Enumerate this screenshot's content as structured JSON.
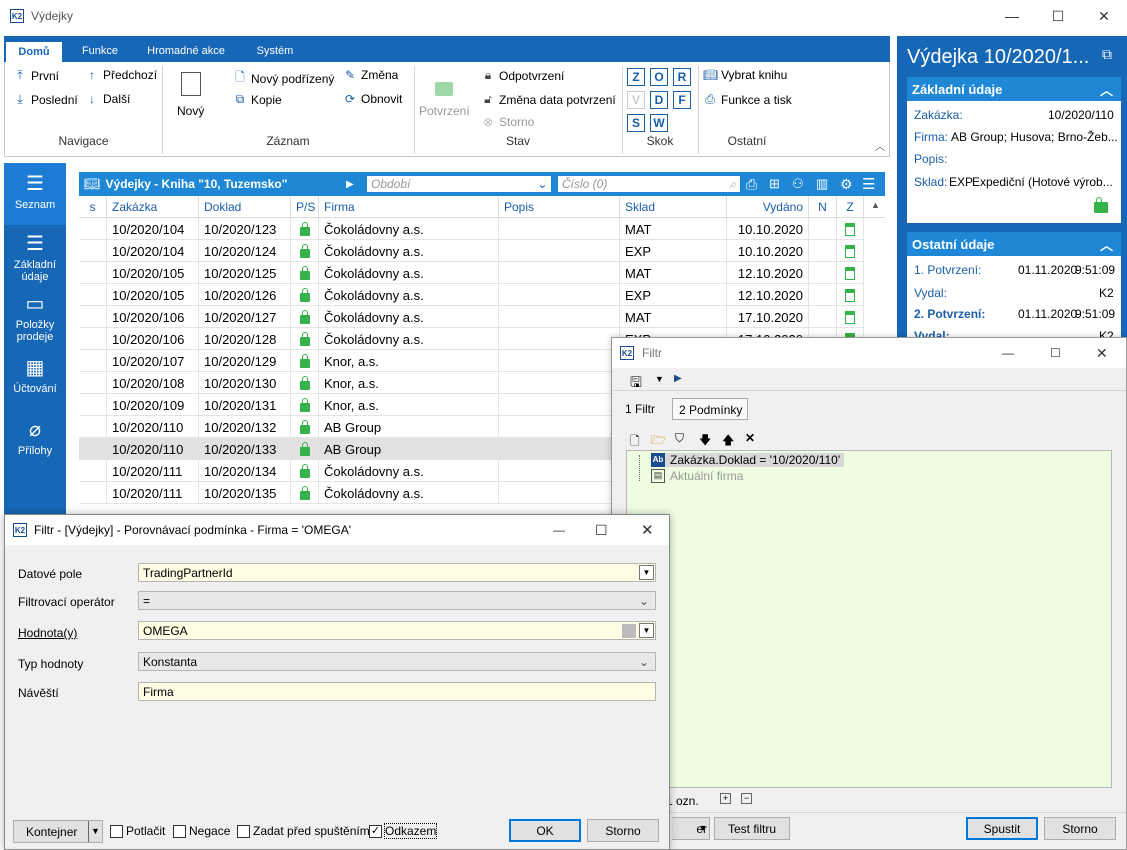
{
  "app": {
    "title": "Výdejky"
  },
  "ribbon": {
    "tabs": [
      "Domů",
      "Funkce",
      "Hromadné akce",
      "Systém"
    ],
    "nav": {
      "first": "První",
      "prev": "Předchozí",
      "last": "Poslední",
      "next": "Další",
      "group": "Navigace"
    },
    "record": {
      "new": "Nový",
      "new_child": "Nový podřízený",
      "copy": "Kopie",
      "change": "Změna",
      "refresh": "Obnovit",
      "group": "Záznam"
    },
    "state": {
      "confirm": "Potvrzení",
      "unconfirm": "Odpotvrzení",
      "change_date": "Změna data potvrzení",
      "cancel": "Storno",
      "group": "Stav"
    },
    "jump": {
      "letters": [
        "Z",
        "O",
        "R",
        "V",
        "D",
        "F",
        "S",
        "W"
      ],
      "group": "Skok"
    },
    "other": {
      "choose_book": "Vybrat knihu",
      "functions_print": "Funkce a tisk",
      "group": "Ostatní"
    }
  },
  "sidebar": {
    "items": [
      {
        "label": "Seznam",
        "icon": "list-icon"
      },
      {
        "label": "Základní údaje",
        "icon": "details-icon"
      },
      {
        "label": "Položky prodeje",
        "icon": "box-icon"
      },
      {
        "label": "Účtování",
        "icon": "calculator-icon"
      },
      {
        "label": "Přílohy",
        "icon": "paperclip-icon"
      }
    ]
  },
  "grid": {
    "title": "Výdejky - Kniha \"10, Tuzemsko\"",
    "period_placeholder": "Období",
    "number_placeholder": "Číslo (0)",
    "columns": [
      "s",
      "Zakázka",
      "Doklad",
      "P/S",
      "Firma",
      "Popis",
      "Sklad",
      "Vydáno",
      "N",
      "Z"
    ],
    "rows": [
      {
        "zakazka": "10/2020/104",
        "doklad": "10/2020/123",
        "firma": "Čokoládovny a.s.",
        "sklad": "MAT",
        "vydano": "10.10.2020"
      },
      {
        "zakazka": "10/2020/104",
        "doklad": "10/2020/124",
        "firma": "Čokoládovny a.s.",
        "sklad": "EXP",
        "vydano": "10.10.2020"
      },
      {
        "zakazka": "10/2020/105",
        "doklad": "10/2020/125",
        "firma": "Čokoládovny a.s.",
        "sklad": "MAT",
        "vydano": "12.10.2020"
      },
      {
        "zakazka": "10/2020/105",
        "doklad": "10/2020/126",
        "firma": "Čokoládovny a.s.",
        "sklad": "EXP",
        "vydano": "12.10.2020"
      },
      {
        "zakazka": "10/2020/106",
        "doklad": "10/2020/127",
        "firma": "Čokoládovny a.s.",
        "sklad": "MAT",
        "vydano": "17.10.2020"
      },
      {
        "zakazka": "10/2020/106",
        "doklad": "10/2020/128",
        "firma": "Čokoládovny a.s.",
        "sklad": "EXP",
        "vydano": "17.10.2020"
      },
      {
        "zakazka": "10/2020/107",
        "doklad": "10/2020/129",
        "firma": "Knor, a.s.",
        "sklad": "",
        "vydano": ""
      },
      {
        "zakazka": "10/2020/108",
        "doklad": "10/2020/130",
        "firma": "Knor, a.s.",
        "sklad": "",
        "vydano": ""
      },
      {
        "zakazka": "10/2020/109",
        "doklad": "10/2020/131",
        "firma": "Knor, a.s.",
        "sklad": "",
        "vydano": ""
      },
      {
        "zakazka": "10/2020/110",
        "doklad": "10/2020/132",
        "firma": "AB Group",
        "sklad": "",
        "vydano": ""
      },
      {
        "zakazka": "10/2020/110",
        "doklad": "10/2020/133",
        "firma": "AB Group",
        "sklad": "",
        "vydano": ""
      },
      {
        "zakazka": "10/2020/111",
        "doklad": "10/2020/134",
        "firma": "Čokoládovny a.s.",
        "sklad": "",
        "vydano": ""
      },
      {
        "zakazka": "10/2020/111",
        "doklad": "10/2020/135",
        "firma": "Čokoládovny a.s.",
        "sklad": "",
        "vydano": ""
      }
    ]
  },
  "detail": {
    "title": "Výdejka 10/2020/1...",
    "basic_header": "Základní údaje",
    "zakazka_label": "Zakázka:",
    "zakazka_value": "10/2020/110",
    "firma_label": "Firma:",
    "firma_value": "AB Group; Husova; Brno-Žeb...",
    "popis_label": "Popis:",
    "sklad_label": "Sklad:",
    "sklad_code": "EXP",
    "sklad_value": "Expediční (Hotové výrob...",
    "other_header": "Ostatní údaje",
    "conf1_label": "1. Potvrzení:",
    "conf1_date": "01.11.2020",
    "conf1_time": "9:51:09",
    "issued_label": "Vydal:",
    "issued_value": "K2",
    "conf2_label": "2. Potvrzení:",
    "conf2_date": "01.11.2020",
    "conf2_time": "9:51:09",
    "issued2_label": "Vydal:",
    "issued2_value": "K2"
  },
  "filter_window": {
    "title": "Filtr",
    "tab1": "1 Filtr",
    "tab2": "2 Podmínky",
    "cond1": "Zakázka.Doklad = '10/2020/110'",
    "cond2": "Aktuální firma",
    "count": "1 ozn.",
    "test_label": "Test filtru",
    "run_label": "Spustit",
    "cancel_label": "Storno",
    "partial_button": "er"
  },
  "dialog": {
    "title": "Filtr - [Výdejky] - Porovnávací podmínka - Firma = 'OMEGA'",
    "field_label": "Datové pole",
    "field_value": "TradingPartnerId",
    "op_label": "Filtrovací operátor",
    "op_value": "=",
    "value_label": "Hodnota(y)",
    "value_value": "OMEGA",
    "type_label": "Typ hodnoty",
    "type_value": "Konstanta",
    "caption_label": "Návěští",
    "caption_value": "Firma",
    "container": "Kontejner",
    "suppress": "Potlačit",
    "negation": "Negace",
    "ask": "Zadat před spuštěním",
    "link": "Odkazem",
    "ok": "OK",
    "cancel": "Storno"
  }
}
